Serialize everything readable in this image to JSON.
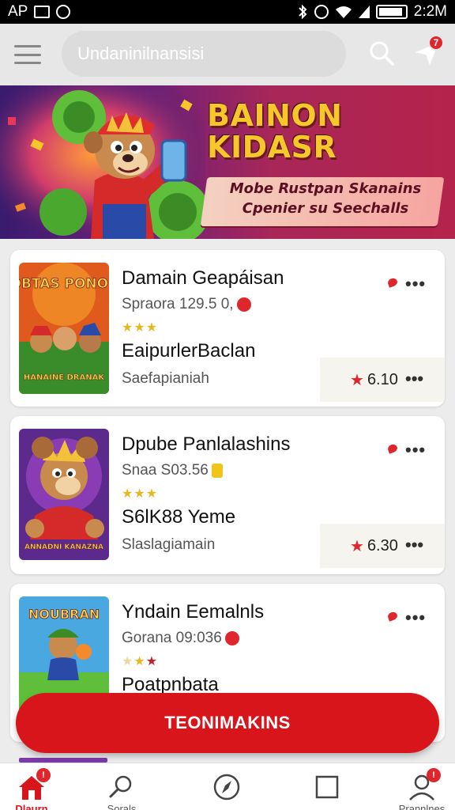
{
  "status_bar": {
    "carrier": "AP",
    "time": "2:2M",
    "battery_level": 0.9
  },
  "app_bar": {
    "search_text": "Undaninilnansisi",
    "notification_count": "7"
  },
  "banner": {
    "title": "BAINON KIDASR",
    "subtitle_line1": "Mobe Rustpan Skanains",
    "subtitle_line2": "Cpenier su Seechalls"
  },
  "cards": [
    {
      "title": "Damain Geapáisan",
      "meta": "Spraora 129.5 0,",
      "stars": 3,
      "subtitle": "EaipurlerBaclan",
      "note": "Saefapianiah",
      "rating": "6.10",
      "thumb_text_top": "BOBTAS PONORS",
      "thumb_text_bottom": "HANAINE DRANAK"
    },
    {
      "title": "Dpube Panlalashins",
      "meta": "Snaa S03.56",
      "stars": 3,
      "subtitle": "S6lK88 Yeme",
      "note": "Slaslagiamain",
      "rating": "6.30",
      "thumb_text_bottom": "ANNADNI KANAZNA"
    },
    {
      "title": "Yndain Eemalnls",
      "meta": "Gorana 09:036",
      "stars": 3,
      "subtitle": "Poatpnbata",
      "thumb_text_top": "NOUBRAN"
    }
  ],
  "cta": {
    "label": "TEONIMAKINS"
  },
  "bottom_nav": [
    {
      "label": "Dlaurn",
      "icon": "home-icon",
      "active": true,
      "badge": "!"
    },
    {
      "label": "Sorals",
      "icon": "search-icon",
      "active": false
    },
    {
      "label": "",
      "icon": "compass-icon",
      "active": false
    },
    {
      "label": "",
      "icon": "square-icon",
      "active": false
    },
    {
      "label": "Prannlnes",
      "icon": "profile-icon",
      "active": false,
      "badge": "!"
    }
  ],
  "colors": {
    "accent": "#d7151b",
    "star": "#e8b823",
    "banner_title": "#f7c62a"
  }
}
